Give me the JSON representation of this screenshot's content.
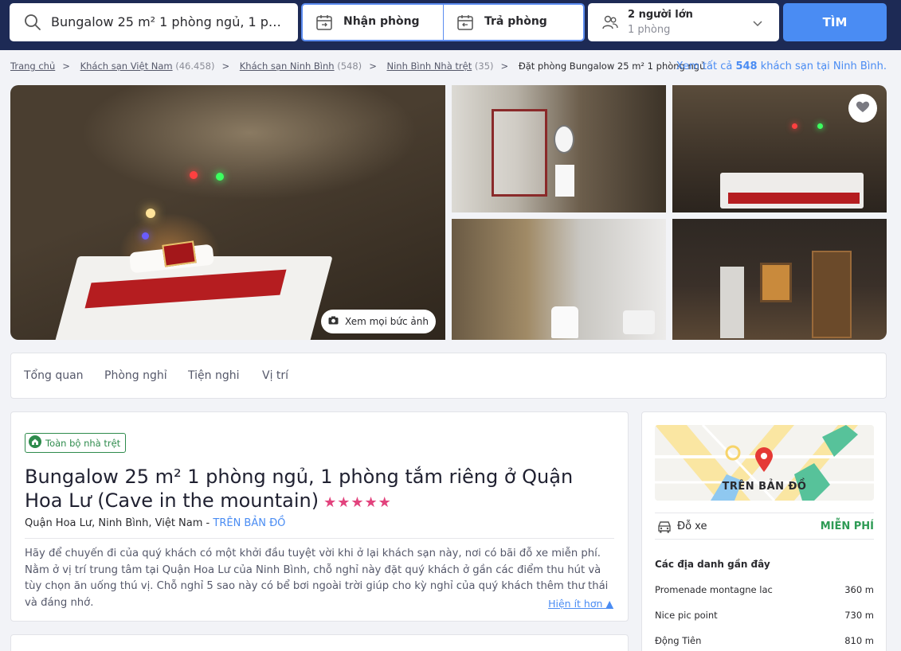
{
  "search": {
    "query": "Bungalow 25 m² 1 phòng ngủ, 1 phòn...",
    "checkin_label": "Nhận phòng",
    "checkout_label": "Trả phòng",
    "guests_line1": "2 người lớn",
    "guests_line2": "1 phòng",
    "search_button": "TÌM"
  },
  "breadcrumb": {
    "items": [
      {
        "label": "Trang chủ",
        "count": ""
      },
      {
        "label": "Khách sạn Việt Nam",
        "count": "(46.458)"
      },
      {
        "label": "Khách sạn Ninh Bình",
        "count": "(548)"
      },
      {
        "label": "Ninh Bình Nhà trệt",
        "count": "(35)"
      }
    ],
    "current": "Đặt phòng Bungalow 25 m² 1 phòng ngủ",
    "see_all_prefix": "Xem tất cả",
    "see_all_count": "548",
    "see_all_suffix": "khách sạn tại Ninh Bình."
  },
  "gallery": {
    "see_all_photos": "Xem mọi bức ảnh"
  },
  "tabs": [
    "Tổng quan",
    "Phòng nghỉ",
    "Tiện nghi",
    "Vị trí"
  ],
  "property": {
    "badge": "Toàn bộ nhà trệt",
    "title": "Bungalow 25 m² 1 phòng ngủ, 1 phòng tắm riêng ở Quận Hoa Lư (Cave in the mountain)",
    "stars": "★★★★★",
    "star_count": 5,
    "address": "Quận Hoa Lư, Ninh Bình, Việt Nam -",
    "map_link": "TRÊN BẢN ĐỒ",
    "description": "Hãy để chuyến đi của quý khách có một khởi đầu tuyệt vời khi ở lại khách sạn này, nơi có bãi đỗ xe miễn phí. Nằm ở vị trí trung tâm tại Quận Hoa Lư của Ninh Bình, chỗ nghỉ này đặt quý khách ở gần các điểm thu hút và tùy chọn ăn uống thú vị. Chỗ nghỉ 5 sao này có bể bơi ngoài trời giúp cho kỳ nghỉ của quý khách thêm thư thái và đáng nhớ.",
    "show_less": "Hiện ít hơn ▲"
  },
  "sidebar": {
    "map_label": "TRÊN BẢN ĐỒ",
    "parking_label": "Đỗ xe",
    "parking_value": "MIỄN PHÍ",
    "nearby_heading": "Các địa danh gần đây",
    "nearby": [
      {
        "name": "Promenade montagne lac",
        "distance": "360 m"
      },
      {
        "name": "Nice pic point",
        "distance": "730 m"
      },
      {
        "name": "Động Tiên",
        "distance": "810 m"
      }
    ]
  },
  "colors": {
    "header_bg": "#1d2a55",
    "accent_blue": "#4a8cf3",
    "star_pink": "#e2437d",
    "free_green": "#2e9b55"
  }
}
